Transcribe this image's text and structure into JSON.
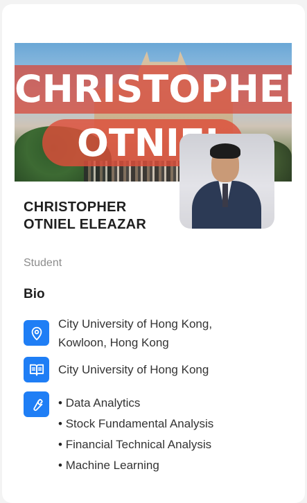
{
  "cover": {
    "line1": "CHRISTOPHER",
    "line2": "OTNIEL"
  },
  "profile": {
    "name": "CHRISTOPHER OTNIEL ELEAZAR",
    "role": "Student"
  },
  "bio": {
    "heading": "Bio",
    "location": "City University of Hong Kong, Kowloon, Hong Kong",
    "location_line1": "City University of Hong Kong,",
    "location_line2": "Kowloon, Hong Kong",
    "education": "City University of Hong Kong",
    "skills": [
      "Data Analytics",
      "Stock Fundamental Analysis",
      "Financial Technical Analysis",
      "Machine Learning"
    ]
  },
  "icons": {
    "location": "map-pin-icon",
    "education": "book-icon",
    "skills": "wrench-icon"
  },
  "colors": {
    "accent": "#1f7ef5",
    "name": "#1f1f1f",
    "role": "#8c8c8c"
  }
}
